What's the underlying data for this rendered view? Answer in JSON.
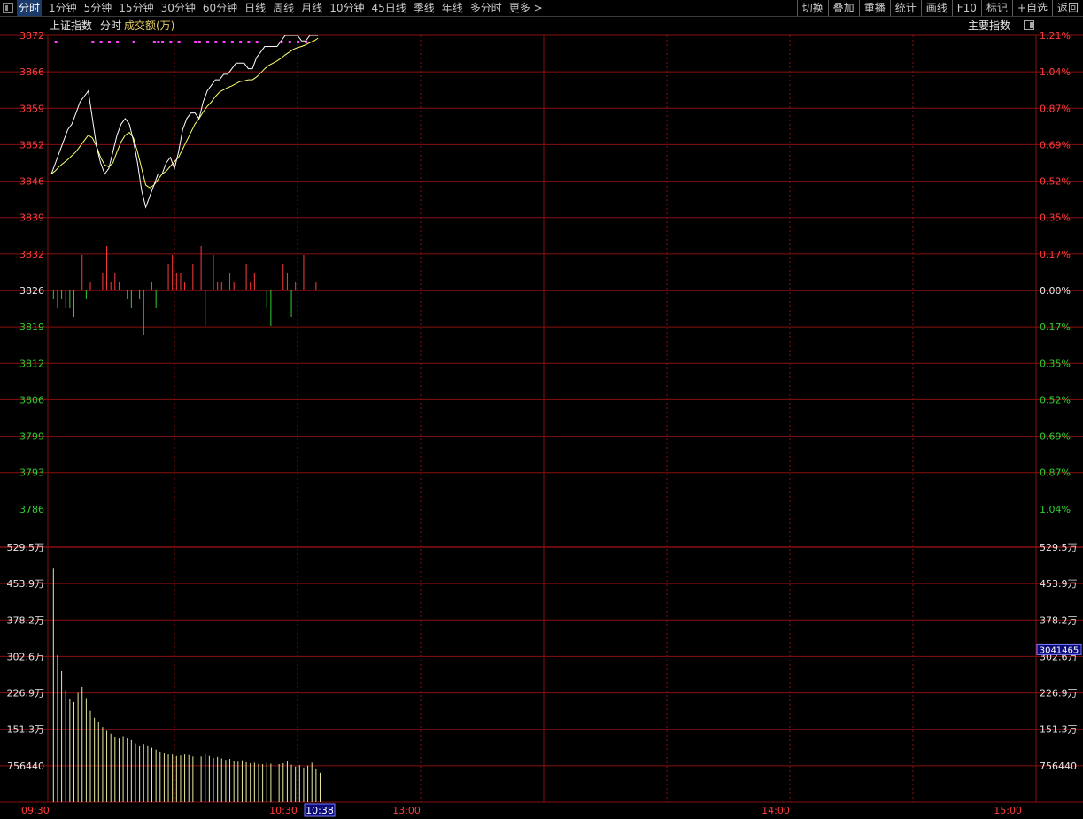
{
  "toolbar": {
    "periods": [
      "分时",
      "1分钟",
      "5分钟",
      "15分钟",
      "30分钟",
      "60分钟",
      "日线",
      "周线",
      "月线",
      "10分钟",
      "45日线",
      "季线",
      "年线",
      "多分时",
      "更多 >"
    ],
    "active_period": "分时",
    "actions": [
      "切换",
      "叠加",
      "重播",
      "统计",
      "画线",
      "F10",
      "标记",
      "+自选",
      "返回"
    ]
  },
  "chart_header": {
    "index_name": "上证指数",
    "mode": "分时",
    "volume_label": "成交额(万)",
    "main_index_label": "主要指数"
  },
  "colors": {
    "grid": "#8a0f0f",
    "up": "#ff3c3c",
    "down": "#2fcf2f",
    "neutral": "#e6e6e6",
    "price_line": "#ffffff",
    "avg_line": "#ffff70",
    "volume_bar": "#e8e8a0",
    "signal_dot": "#ff40ff"
  },
  "chart_data": {
    "type": "line",
    "price_axis": {
      "up_ticks": [
        "3872",
        "3866",
        "3859",
        "3852",
        "3846",
        "3839",
        "3832"
      ],
      "base": "3826",
      "down_ticks": [
        "3819",
        "3812",
        "3806",
        "3799",
        "3793",
        "3786"
      ]
    },
    "percent_axis": {
      "up_ticks": [
        "1.21%",
        "1.04%",
        "0.87%",
        "0.69%",
        "0.52%",
        "0.35%",
        "0.17%"
      ],
      "base": "0.00%",
      "down_ticks": [
        "0.17%",
        "0.35%",
        "0.52%",
        "0.69%",
        "0.87%",
        "1.04%"
      ]
    },
    "volume_axis": {
      "ticks": [
        "529.5万",
        "453.9万",
        "378.2万",
        "302.6万",
        "226.9万",
        "151.3万",
        "756440"
      ],
      "current_value": "3041465"
    },
    "time_axis": {
      "start": "09:30",
      "labels": [
        {
          "minute": 60,
          "label": "10:30"
        },
        {
          "minute": 90,
          "label": "13:00"
        },
        {
          "minute": 180,
          "label": "14:00"
        },
        {
          "minute": 240,
          "label": "15:00"
        }
      ],
      "cursor_label": "10:38",
      "total_minutes": 240
    },
    "price_ylim": [
      3786,
      3872
    ],
    "volume_ylim": [
      0,
      5295000
    ],
    "price": [
      3847,
      3849,
      3851,
      3853,
      3855,
      3856,
      3858,
      3860,
      3861,
      3862,
      3857,
      3852,
      3849,
      3847,
      3848,
      3851,
      3854,
      3856,
      3857,
      3856,
      3853,
      3849,
      3844,
      3841,
      3843,
      3845,
      3847,
      3847,
      3849,
      3850,
      3848,
      3851,
      3855,
      3857,
      3858,
      3858,
      3857,
      3860,
      3862,
      3863,
      3864,
      3864,
      3865,
      3865,
      3866,
      3867,
      3867,
      3867,
      3866,
      3866,
      3868,
      3869,
      3870,
      3870,
      3870,
      3870,
      3871,
      3872,
      3872,
      3872,
      3872,
      3871,
      3871,
      3872,
      3872,
      3872
    ],
    "avg": [
      3847,
      3847.6,
      3848.4,
      3849,
      3849.6,
      3850.3,
      3851,
      3852,
      3853,
      3854,
      3853.5,
      3852,
      3850,
      3848.6,
      3848.3,
      3849,
      3851,
      3852.8,
      3854,
      3854.5,
      3853.5,
      3851,
      3848,
      3845,
      3844.5,
      3845,
      3846,
      3847,
      3847.5,
      3848.4,
      3849.2,
      3850,
      3851.5,
      3853,
      3854.5,
      3856,
      3857,
      3858.2,
      3859.2,
      3860,
      3861,
      3861.8,
      3862.2,
      3862.6,
      3862.9,
      3863.3,
      3863.7,
      3863.8,
      3864,
      3864,
      3864.5,
      3865.2,
      3866,
      3866.6,
      3867,
      3867.4,
      3867.9,
      3868.5,
      3869,
      3869.5,
      3869.8,
      3870,
      3870.3,
      3870.7,
      3871,
      3871.5
    ],
    "ratio": [
      -1,
      -2,
      -1,
      -2,
      -2,
      -3,
      0,
      4,
      -1,
      1,
      0,
      0,
      2,
      5,
      1,
      2,
      1,
      0,
      -1,
      -2,
      0,
      -1,
      -5,
      0,
      1,
      -2,
      0,
      0,
      3,
      4,
      2,
      2,
      1,
      0,
      3,
      2,
      5,
      -4,
      0,
      4,
      1,
      1,
      0,
      2,
      1,
      0,
      0,
      3,
      1,
      2,
      0,
      0,
      -2,
      -4,
      -2,
      0,
      3,
      2,
      -3,
      1,
      0,
      4,
      0,
      0,
      1,
      0
    ],
    "volume": [
      4850000,
      3050000,
      2720000,
      2330000,
      2150000,
      2080000,
      2270000,
      2390000,
      2160000,
      1900000,
      1750000,
      1670000,
      1560000,
      1480000,
      1420000,
      1360000,
      1320000,
      1370000,
      1340000,
      1290000,
      1220000,
      1160000,
      1210000,
      1180000,
      1130000,
      1090000,
      1050000,
      1010000,
      990000,
      990000,
      960000,
      970000,
      990000,
      980000,
      950000,
      930000,
      950000,
      1000000,
      960000,
      920000,
      940000,
      910000,
      880000,
      900000,
      860000,
      840000,
      870000,
      830000,
      810000,
      820000,
      800000,
      790000,
      820000,
      800000,
      770000,
      790000,
      810000,
      850000,
      780000,
      740000,
      770000,
      720000,
      760000,
      820000,
      700000,
      610000
    ],
    "signal_minutes": [
      1,
      10,
      12,
      14,
      16,
      20,
      25,
      26,
      27,
      29,
      31,
      35,
      36,
      38,
      40,
      42,
      44,
      46,
      48,
      50,
      56,
      58,
      60,
      62
    ]
  }
}
